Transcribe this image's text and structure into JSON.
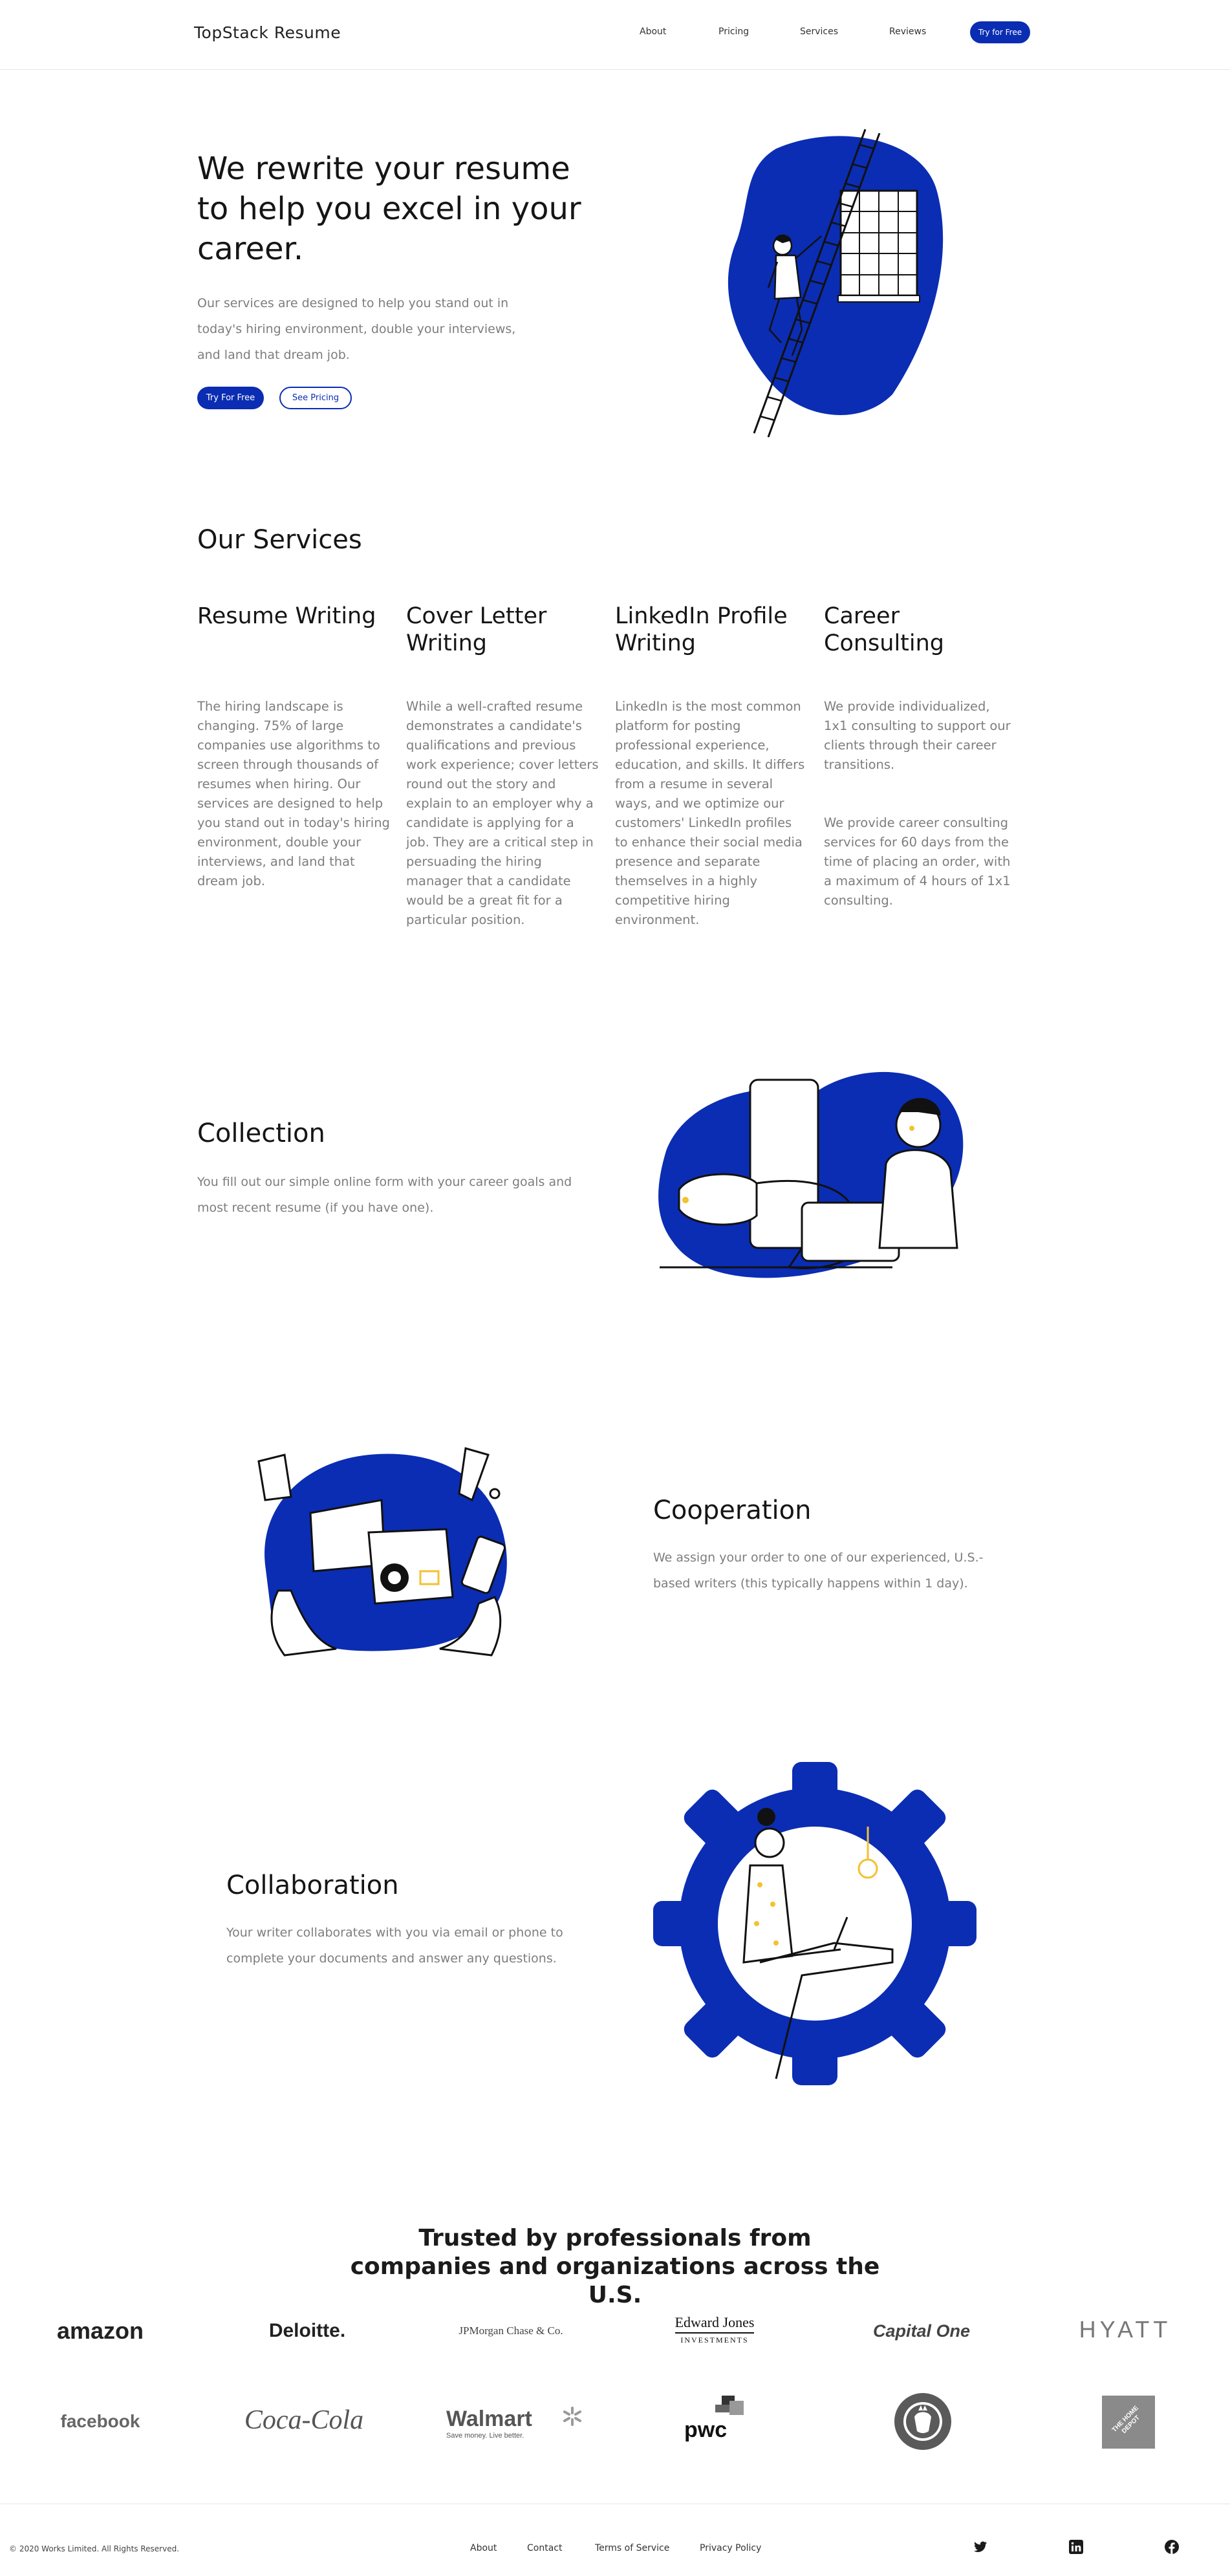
{
  "header": {
    "brand": "TopStack Resume",
    "nav": [
      "About",
      "Pricing",
      "Services",
      "Reviews"
    ],
    "cta": "Try for Free"
  },
  "hero": {
    "title": "We rewrite your resume to help you excel in your career.",
    "text": "Our services are designed to help you stand out in today's hiring environment, double your interviews, and land that dream job.",
    "primary_button": "Try For Free",
    "secondary_button": "See Pricing"
  },
  "services": {
    "heading": "Our Services",
    "items": [
      {
        "title": "Resume Writing",
        "text": "The hiring landscape is changing. 75% of large companies use algorithms to screen through thousands of resumes when hiring. Our services are designed to help you stand out in today's hiring environment, double your interviews, and land that dream job."
      },
      {
        "title": "Cover Letter Writing",
        "text": "While a well-crafted resume demonstrates a candidate's qualifications and previous work experience; cover letters round out the story and explain to an employer why a candidate is applying for a job. They are a critical step in persuading the hiring manager that a candidate would be a great fit for a particular position."
      },
      {
        "title": "LinkedIn Profile Writing",
        "text": "LinkedIn is the most common platform for posting professional experience, education, and skills. It differs from a resume in several ways, and we optimize our customers' LinkedIn profiles to enhance their social media presence and separate themselves in a highly competitive hiring environment."
      },
      {
        "title": "Career Consulting",
        "text": "We provide individualized, 1x1 consulting to support our clients through their career transitions.",
        "text2": "We provide career consulting services for 60 days from the time of placing an order, with a maximum of 4 hours of 1x1 consulting."
      }
    ]
  },
  "steps": {
    "collection": {
      "title": "Collection",
      "text": "You fill out our simple online form with your career goals and most recent resume (if you have one)."
    },
    "cooperation": {
      "title": "Cooperation",
      "text": "We assign your order to one of our experienced, U.S.-based writers (this typically happens within 1 day)."
    },
    "collaboration": {
      "title": "Collaboration",
      "text": "Your writer collaborates with you via email or phone to complete your documents and answer any questions."
    }
  },
  "trusted": {
    "heading": "Trusted by professionals from companies and organizations across the U.S.",
    "logos": [
      "amazon",
      "Deloitte.",
      "JPMorgan Chase & Co.",
      "Edward Jones",
      "INVESTMENTS",
      "Capital One",
      "HYATT",
      "facebook",
      "Coca-Cola",
      "Walmart",
      "Save money. Live better.",
      "pwc",
      "THE HOME DEPOT"
    ]
  },
  "footer": {
    "copyright": "© 2020 Works Limited. All Rights Reserved.",
    "links": [
      "About",
      "Contact",
      "Terms of Service",
      "Privacy Policy"
    ]
  },
  "colors": {
    "accent": "#0b2db3",
    "highlight": "#f2c230",
    "muted_text": "#7d7d7d"
  }
}
